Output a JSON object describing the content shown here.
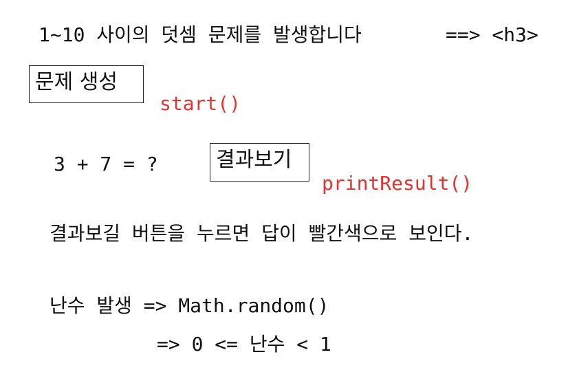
{
  "heading": {
    "text": "1~10 사이의 덧셈 문제를 발생합니다",
    "tag_note": "==> <h3>"
  },
  "generate_button": {
    "label": "문제 생성",
    "function_note": "start()"
  },
  "problem": {
    "expression": "3 + 7 = ?"
  },
  "result_button": {
    "label": "결과보기",
    "function_note": "printResult()"
  },
  "description": "결과보길 버튼을 누르면 답이 빨간색으로 보인다.",
  "random_note": {
    "line1": "난수 발생 => Math.random()",
    "line2": "=> 0 <= 난수 < 1"
  },
  "colors": {
    "annotation": "#e8322f",
    "text": "#111111"
  }
}
